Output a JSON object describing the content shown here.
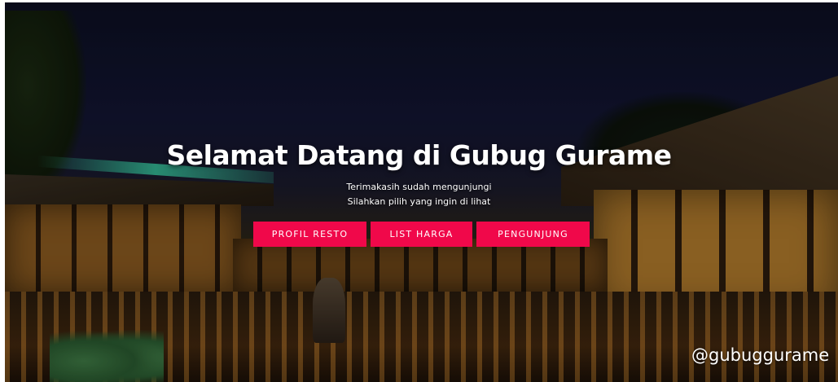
{
  "hero": {
    "title": "Selamat Datang di Gubug Gurame",
    "subtitle_line1": "Terimakasih sudah mengunjungi",
    "subtitle_line2": "Silahkan pilih yang ingin di lihat",
    "watermark": "@gubuggurame"
  },
  "buttons": {
    "profil": "PROFIL RESTO",
    "harga": "LIST HARGA",
    "pengunjung": "PENGUNJUNG"
  },
  "colors": {
    "button_bg": "#f0084a",
    "text": "#ffffff"
  }
}
